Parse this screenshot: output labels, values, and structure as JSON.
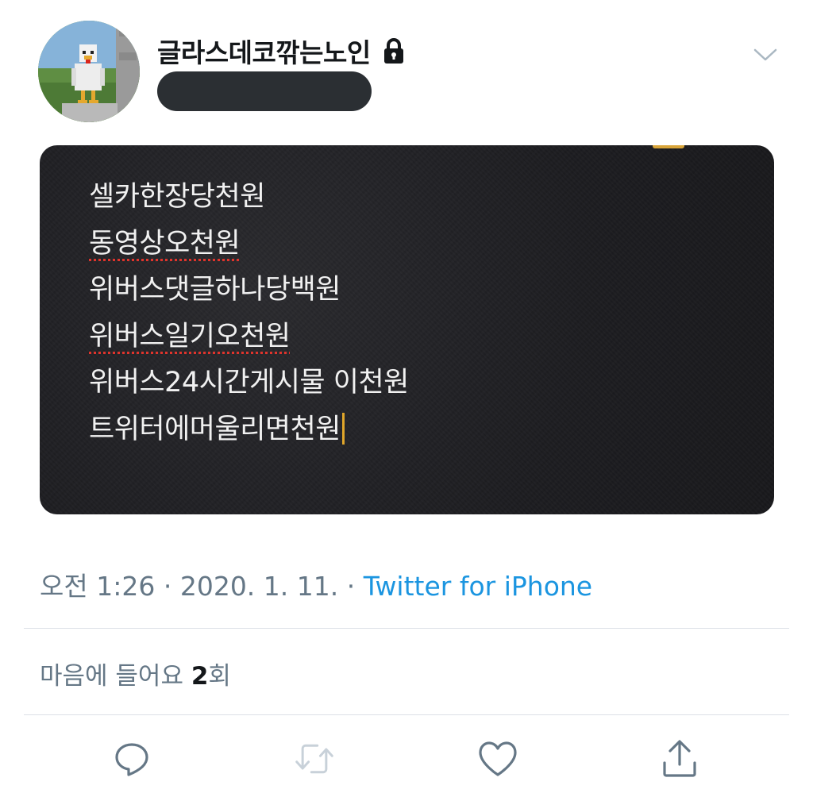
{
  "author": {
    "display_name": "글라스데코깎는노인",
    "protected_icon": "lock-icon",
    "avatar_icon": "pixel-chicken-avatar",
    "handle_redacted": true
  },
  "header": {
    "menu_icon": "chevron-down-icon"
  },
  "media": {
    "type": "screenshot-of-notes",
    "lines": [
      "셀카한장당천원",
      "동영상오천원",
      "위버스댓글하나당백원",
      "위버스일기오천원",
      "위버스24시간게시물 이천원",
      "트위터에머울리면천원"
    ]
  },
  "meta": {
    "time": "오전 1:26",
    "date": "2020. 1. 11.",
    "separator": "·",
    "source": "Twitter for iPhone"
  },
  "likes": {
    "prefix": "마음에 들어요",
    "count": "2",
    "suffix": "회"
  },
  "actions": [
    {
      "icon": "reply-icon"
    },
    {
      "icon": "retweet-icon",
      "disabled": true
    },
    {
      "icon": "heart-icon"
    },
    {
      "icon": "share-icon"
    }
  ],
  "colors": {
    "link": "#1b95e0",
    "meta_text": "#657786",
    "primary_text": "#14171a",
    "media_bg": "#1c1c20",
    "spellcheck": "#e0342c",
    "caret": "#e0a62a"
  }
}
